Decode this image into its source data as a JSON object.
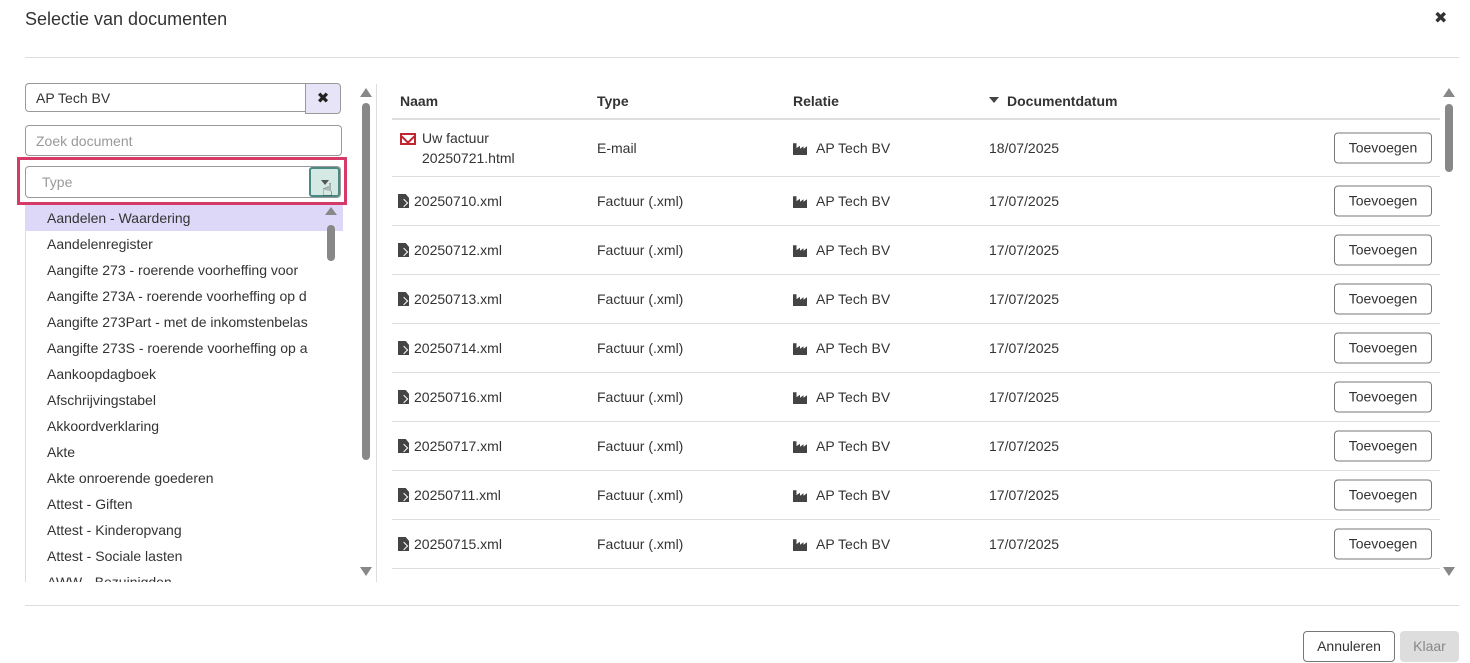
{
  "dialog": {
    "title": "Selectie van documenten",
    "close_glyph": "✖"
  },
  "filters": {
    "client_value": "AP Tech BV",
    "clear_glyph": "✖",
    "search_placeholder": "Zoek document",
    "type_placeholder": "Type"
  },
  "type_options": [
    "Aandelen - Waardering",
    "Aandelenregister",
    "Aangifte 273 - roerende voorheffing voor",
    "Aangifte 273A - roerende voorheffing op d",
    "Aangifte 273Part - met de inkomstenbelas",
    "Aangifte 273S - roerende voorheffing op a",
    "Aankoopdagboek",
    "Afschrijvingstabel",
    "Akkoordverklaring",
    "Akte",
    "Akte onroerende goederen",
    "Attest - Giften",
    "Attest - Kinderopvang",
    "Attest - Sociale lasten",
    "AWW - Bezuinigden"
  ],
  "table": {
    "headers": {
      "name": "Naam",
      "type": "Type",
      "relation": "Relatie",
      "date": "Documentdatum"
    },
    "add_label": "Toevoegen",
    "rows": [
      {
        "icon": "email-icon",
        "name": "Uw factuur 20250721.html",
        "type": "E-mail",
        "relation": "AP Tech BV",
        "date": "18/07/2025"
      },
      {
        "icon": "xml-file-icon",
        "name": "20250710.xml",
        "type": "Factuur (.xml)",
        "relation": "AP Tech BV",
        "date": "17/07/2025"
      },
      {
        "icon": "xml-file-icon",
        "name": "20250712.xml",
        "type": "Factuur (.xml)",
        "relation": "AP Tech BV",
        "date": "17/07/2025"
      },
      {
        "icon": "xml-file-icon",
        "name": "20250713.xml",
        "type": "Factuur (.xml)",
        "relation": "AP Tech BV",
        "date": "17/07/2025"
      },
      {
        "icon": "xml-file-icon",
        "name": "20250714.xml",
        "type": "Factuur (.xml)",
        "relation": "AP Tech BV",
        "date": "17/07/2025"
      },
      {
        "icon": "xml-file-icon",
        "name": "20250716.xml",
        "type": "Factuur (.xml)",
        "relation": "AP Tech BV",
        "date": "17/07/2025"
      },
      {
        "icon": "xml-file-icon",
        "name": "20250717.xml",
        "type": "Factuur (.xml)",
        "relation": "AP Tech BV",
        "date": "17/07/2025"
      },
      {
        "icon": "xml-file-icon",
        "name": "20250711.xml",
        "type": "Factuur (.xml)",
        "relation": "AP Tech BV",
        "date": "17/07/2025"
      },
      {
        "icon": "xml-file-icon",
        "name": "20250715.xml",
        "type": "Factuur (.xml)",
        "relation": "AP Tech BV",
        "date": "17/07/2025"
      }
    ]
  },
  "footer": {
    "cancel_label": "Annuleren",
    "done_label": "Klaar"
  },
  "colors": {
    "highlight": "#d63a67",
    "selected_option": "#ddd8f7",
    "email_icon": "#c0262f"
  }
}
